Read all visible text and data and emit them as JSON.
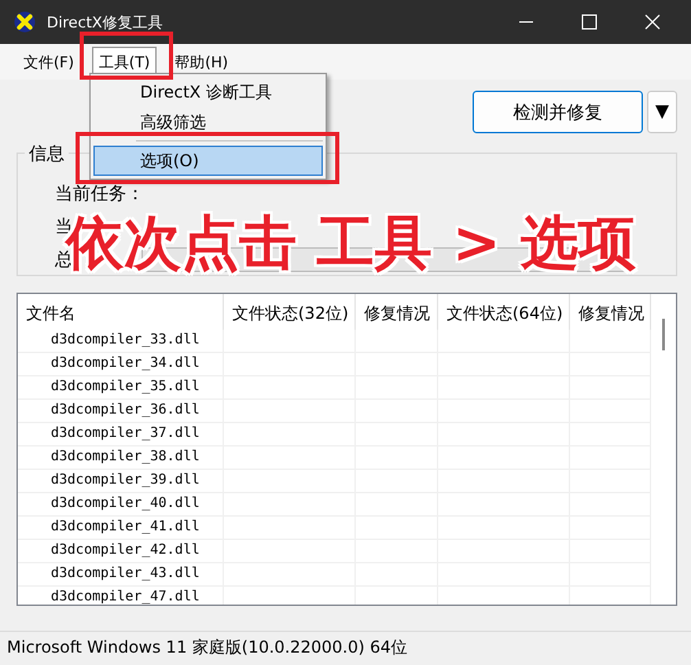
{
  "window": {
    "title": "DirectX修复工具"
  },
  "menubar": [
    {
      "label": "文件(F)",
      "selected": false
    },
    {
      "label": "工具(T)",
      "selected": true
    },
    {
      "label": "帮助(H)",
      "selected": false
    }
  ],
  "dropdown": [
    {
      "kind": "item",
      "label": "DirectX 诊断工具",
      "selected": false
    },
    {
      "kind": "item",
      "label": "高级筛选",
      "selected": false
    },
    {
      "kind": "separator"
    },
    {
      "kind": "item",
      "label": "选项(O)",
      "selected": true
    }
  ],
  "action_button": {
    "label": "检测并修复",
    "arrow": "▼"
  },
  "info": {
    "title": "信息",
    "labels": [
      "当前任务：",
      "当",
      "总"
    ],
    "progress": {
      "level": 0
    }
  },
  "annotation": {
    "text": "依次点击 工具 > 选项"
  },
  "table": {
    "columns": [
      "文件名",
      "文件状态(32位)",
      "修复情况",
      "文件状态(64位)",
      "修复情况"
    ],
    "rows": [
      [
        "d3dcompiler_33.dll",
        "",
        "",
        "",
        ""
      ],
      [
        "d3dcompiler_34.dll",
        "",
        "",
        "",
        ""
      ],
      [
        "d3dcompiler_35.dll",
        "",
        "",
        "",
        ""
      ],
      [
        "d3dcompiler_36.dll",
        "",
        "",
        "",
        ""
      ],
      [
        "d3dcompiler_37.dll",
        "",
        "",
        "",
        ""
      ],
      [
        "d3dcompiler_38.dll",
        "",
        "",
        "",
        ""
      ],
      [
        "d3dcompiler_39.dll",
        "",
        "",
        "",
        ""
      ],
      [
        "d3dcompiler_40.dll",
        "",
        "",
        "",
        ""
      ],
      [
        "d3dcompiler_41.dll",
        "",
        "",
        "",
        ""
      ],
      [
        "d3dcompiler_42.dll",
        "",
        "",
        "",
        ""
      ],
      [
        "d3dcompiler_43.dll",
        "",
        "",
        "",
        ""
      ],
      [
        "d3dcompiler_47.dll",
        "",
        "",
        "",
        ""
      ]
    ]
  },
  "status_bar": {
    "text": "Microsoft Windows 11 家庭版(10.0.22000.0) 64位"
  }
}
